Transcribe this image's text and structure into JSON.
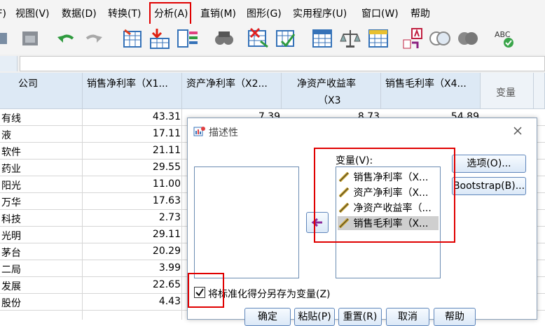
{
  "menubar": {
    "items": [
      "文件(F)",
      "视图(V)",
      "数据(D)",
      "转换(T)",
      "分析(A)",
      "直销(M)",
      "图形(G)",
      "实用程序(U)",
      "窗口(W)",
      "帮助"
    ],
    "highlighted": "分析(A)"
  },
  "grid": {
    "headers": [
      "公司",
      "销售净利率（X1...",
      "资产净利率（X2...",
      "净资产收益率",
      "（X3",
      "销售毛利率（X4...",
      "变量"
    ],
    "rows": [
      {
        "name": "有线",
        "x1": "43.31",
        "x2": "7.39",
        "x3": "8.73",
        "x4": "54.89"
      },
      {
        "name": "液",
        "x1": "17.11"
      },
      {
        "name": "软件",
        "x1": "21.11"
      },
      {
        "name": "药业",
        "x1": "29.55"
      },
      {
        "name": "阳光",
        "x1": "11.00"
      },
      {
        "name": "万华",
        "x1": "17.63"
      },
      {
        "name": "科技",
        "x1": "2.73"
      },
      {
        "name": "光明",
        "x1": "29.11"
      },
      {
        "name": "茅台",
        "x1": "20.29"
      },
      {
        "name": "二局",
        "x1": "3.99"
      },
      {
        "name": "发展",
        "x1": "22.65"
      },
      {
        "name": "股份",
        "x1": "4.43"
      }
    ]
  },
  "dialog": {
    "title": "描述性",
    "variables_label": "变量(V):",
    "variables": [
      "销售净利率（X...",
      "资产净利率（X...",
      "净资产收益率（...",
      "销售毛利率（X..."
    ],
    "selected_variable": "销售毛利率（X...",
    "options_button": "选项(O)...",
    "bootstrap_button": "Bootstrap(B)...",
    "save_standardized_label": "将标准化得分另存为变量(Z)",
    "save_standardized_checked": true,
    "buttons": {
      "ok": "确定",
      "paste": "粘贴(P)",
      "reset": "重置(R)",
      "cancel": "取消",
      "help": "帮助"
    }
  }
}
